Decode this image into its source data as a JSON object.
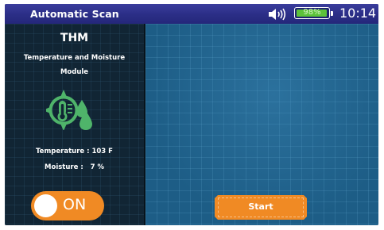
{
  "status_bar": {
    "title": "Automatic Scan",
    "volume_icon": "speaker-volume-icon",
    "battery": {
      "percent_label": "98%",
      "level": 0.98,
      "color": "#5cc23a"
    },
    "time": "10:14",
    "background": "#2b2e86"
  },
  "module": {
    "code": "THM",
    "name_line1": "Temperature and Moisture",
    "name_line2": "Module",
    "icon": "thermometer-droplets-icon",
    "icon_color": "#4fb46a"
  },
  "readings": {
    "temperature": "Temperature : 103 F",
    "moisture": "Moisture :   7 %"
  },
  "toggle": {
    "label": "ON",
    "state": "on",
    "color": "#f08a24"
  },
  "start_button": {
    "label": "Start",
    "color": "#f08a24"
  }
}
